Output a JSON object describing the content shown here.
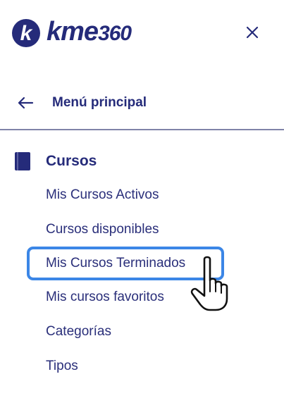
{
  "brand": {
    "name_main": "kme",
    "name_num": "360",
    "badge_letter": "k"
  },
  "nav": {
    "back_label": "Menú principal"
  },
  "section": {
    "title": "Cursos"
  },
  "menu_items": [
    {
      "label": "Mis Cursos Activos"
    },
    {
      "label": "Cursos disponibles"
    },
    {
      "label": "Mis Cursos Terminados",
      "highlighted": true
    },
    {
      "label": "Mis cursos favoritos"
    },
    {
      "label": "Categorías"
    },
    {
      "label": "Tipos"
    }
  ],
  "icons": {
    "close": "close-icon",
    "back": "arrow-left-icon",
    "section": "book-icon",
    "cursor": "hand-pointer-icon"
  },
  "colors": {
    "brand_navy": "#252b7a",
    "text": "#2a2f7a",
    "highlight": "#3b86e6",
    "divider": "#7f83a8"
  }
}
